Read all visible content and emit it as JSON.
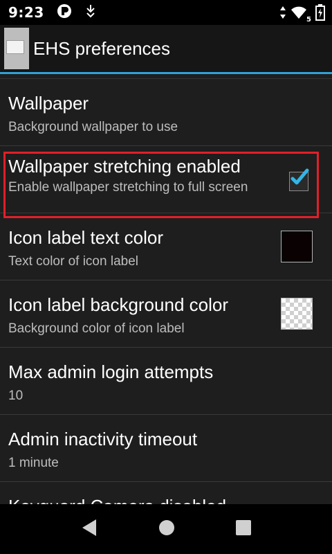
{
  "status_bar": {
    "time": "9:23",
    "left_icons": [
      "notification-icon",
      "download-icon"
    ],
    "right_icons": [
      "data-arrows-icon",
      "wifi-icon",
      "battery-charging-icon"
    ],
    "wifi_badge": "5"
  },
  "action_bar": {
    "title": "EHS preferences",
    "accent_color": "#2fa2d8"
  },
  "preferences": [
    {
      "title": "Wallpaper",
      "summary": "Background wallpaper to use"
    },
    {
      "title": "Wallpaper stretching enabled",
      "summary": "Enable wallpaper stretching to full screen",
      "widget": "checkbox",
      "checked": true
    },
    {
      "title": "Icon label text color",
      "summary": "Text color of icon label",
      "widget": "color",
      "color": "#0a0202"
    },
    {
      "title": "Icon label background color",
      "summary": "Background color of icon label",
      "widget": "color",
      "color": "transparent"
    },
    {
      "title": "Max admin login attempts",
      "summary": "10"
    },
    {
      "title": "Admin inactivity timeout",
      "summary": "1 minute"
    },
    {
      "title": "Keyguard Camera disabled",
      "summary": ""
    }
  ],
  "highlight_color": "#e0202a",
  "nav_bar": {
    "buttons": [
      "back-icon",
      "home-icon",
      "recents-icon"
    ]
  }
}
